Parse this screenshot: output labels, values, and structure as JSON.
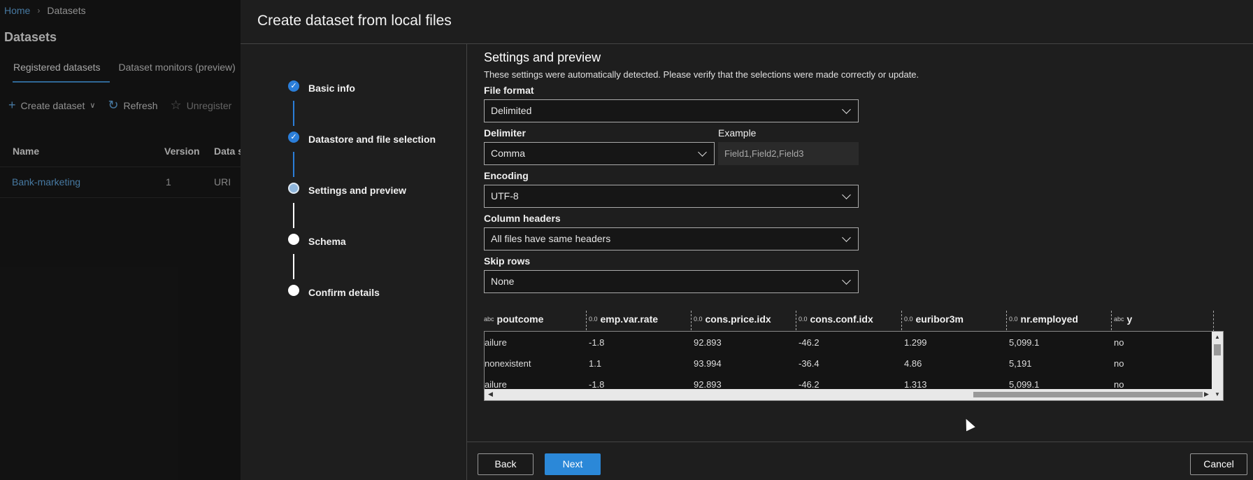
{
  "background": {
    "breadcrumb": {
      "home": "Home",
      "separator": "›",
      "current": "Datasets"
    },
    "title": "Datasets",
    "tabs": [
      "Registered datasets",
      "Dataset monitors (preview)"
    ],
    "toolbar": {
      "create": "Create dataset",
      "refresh": "Refresh",
      "unregister": "Unregister"
    },
    "table": {
      "headers": [
        "Name",
        "Version",
        "Data s"
      ],
      "rows": [
        [
          "Bank-marketing",
          "1",
          "URI"
        ]
      ]
    }
  },
  "panel": {
    "title": "Create dataset from local files",
    "steps": [
      {
        "label": "Basic info",
        "state": "done"
      },
      {
        "label": "Datastore and file selection",
        "state": "done"
      },
      {
        "label": "Settings and preview",
        "state": "current"
      },
      {
        "label": "Schema",
        "state": "todo"
      },
      {
        "label": "Confirm details",
        "state": "todo"
      }
    ],
    "section_title": "Settings and preview",
    "section_desc": "These settings were automatically detected. Please verify that the selections were made correctly or update.",
    "file_format": {
      "label": "File format",
      "value": "Delimited"
    },
    "delimiter": {
      "label": "Delimiter",
      "value": "Comma"
    },
    "example": {
      "label": "Example",
      "value": "Field1,Field2,Field3"
    },
    "encoding": {
      "label": "Encoding",
      "value": "UTF-8"
    },
    "column_headers": {
      "label": "Column headers",
      "value": "All files have same headers"
    },
    "skip_rows": {
      "label": "Skip rows",
      "value": "None"
    },
    "preview": {
      "columns": [
        {
          "name": "poutcome",
          "type_icon": "abc"
        },
        {
          "name": "emp.var.rate",
          "type_icon": "0.0"
        },
        {
          "name": "cons.price.idx",
          "type_icon": "0.0"
        },
        {
          "name": "cons.conf.idx",
          "type_icon": "0.0"
        },
        {
          "name": "euribor3m",
          "type_icon": "0.0"
        },
        {
          "name": "nr.employed",
          "type_icon": "0.0"
        },
        {
          "name": "y",
          "type_icon": "abc"
        }
      ],
      "rows": [
        [
          "ailure",
          "-1.8",
          "92.893",
          "-46.2",
          "1.299",
          "5,099.1",
          "no"
        ],
        [
          "nonexistent",
          "1.1",
          "93.994",
          "-36.4",
          "4.86",
          "5,191",
          "no"
        ],
        [
          "ailure",
          "-1.8",
          "92.893",
          "-46.2",
          "1.313",
          "5,099.1",
          "no"
        ]
      ]
    },
    "buttons": {
      "back": "Back",
      "next": "Next",
      "cancel": "Cancel"
    }
  },
  "colors": {
    "accent": "#2b88d8",
    "link": "#6cb8f6",
    "panel_bg": "#1e1e1e"
  }
}
